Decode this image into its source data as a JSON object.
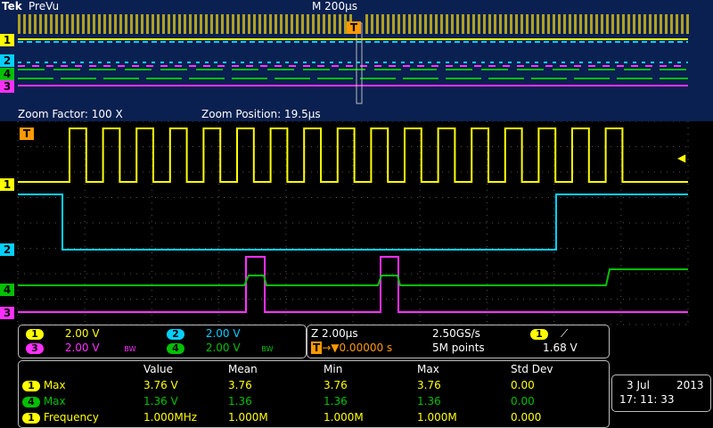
{
  "header": {
    "brand": "Tek",
    "mode": "PreVu",
    "timebase": "M 200µs"
  },
  "zoom": {
    "factor_label": "Zoom Factor: 100 X",
    "position_label": "Zoom Position: 19.5µs"
  },
  "channels": [
    {
      "id": "1",
      "color": "#ffff00"
    },
    {
      "id": "2",
      "color": "#00d0ff"
    },
    {
      "id": "3",
      "color": "#ff30ff"
    },
    {
      "id": "4",
      "color": "#00c000"
    }
  ],
  "trigger_marker": "T",
  "vertical_settings": [
    {
      "ch": "1",
      "value": "2.00 V",
      "color": "#ffff00",
      "bw": ""
    },
    {
      "ch": "2",
      "value": "2.00 V",
      "color": "#00d0ff",
      "bw": ""
    },
    {
      "ch": "3",
      "value": "2.00 V",
      "color": "#ff30ff",
      "bw": "BW"
    },
    {
      "ch": "4",
      "value": "2.00 V",
      "color": "#00c000",
      "bw": "BW"
    }
  ],
  "horizontal": {
    "zoom_scale": "Z 2.00µs",
    "sample_rate": "2.50GS/s",
    "trigger_pos": "▼0.00000 s",
    "record": "5M points",
    "trig_ch": "1",
    "trig_slope": "⟋",
    "trig_level": "1.68 V"
  },
  "measurements": {
    "headers": [
      "Value",
      "Mean",
      "Min",
      "Max",
      "Std Dev"
    ],
    "rows": [
      {
        "ch": "1",
        "name": "Max",
        "color": "#ffff00",
        "values": [
          "3.76 V",
          "3.76",
          "3.76",
          "3.76",
          "0.00"
        ]
      },
      {
        "ch": "4",
        "name": "Max",
        "color": "#00c000",
        "values": [
          "1.36 V",
          "1.36",
          "1.36",
          "1.36",
          "0.00"
        ]
      },
      {
        "ch": "1",
        "name": "Frequency",
        "color": "#ffff00",
        "values": [
          "1.000MHz",
          "1.000M",
          "1.000M",
          "1.000M",
          "0.000"
        ]
      }
    ]
  },
  "datetime": {
    "date_day": "3 Jul",
    "date_year": "2013",
    "time": "17: 11: 33"
  }
}
